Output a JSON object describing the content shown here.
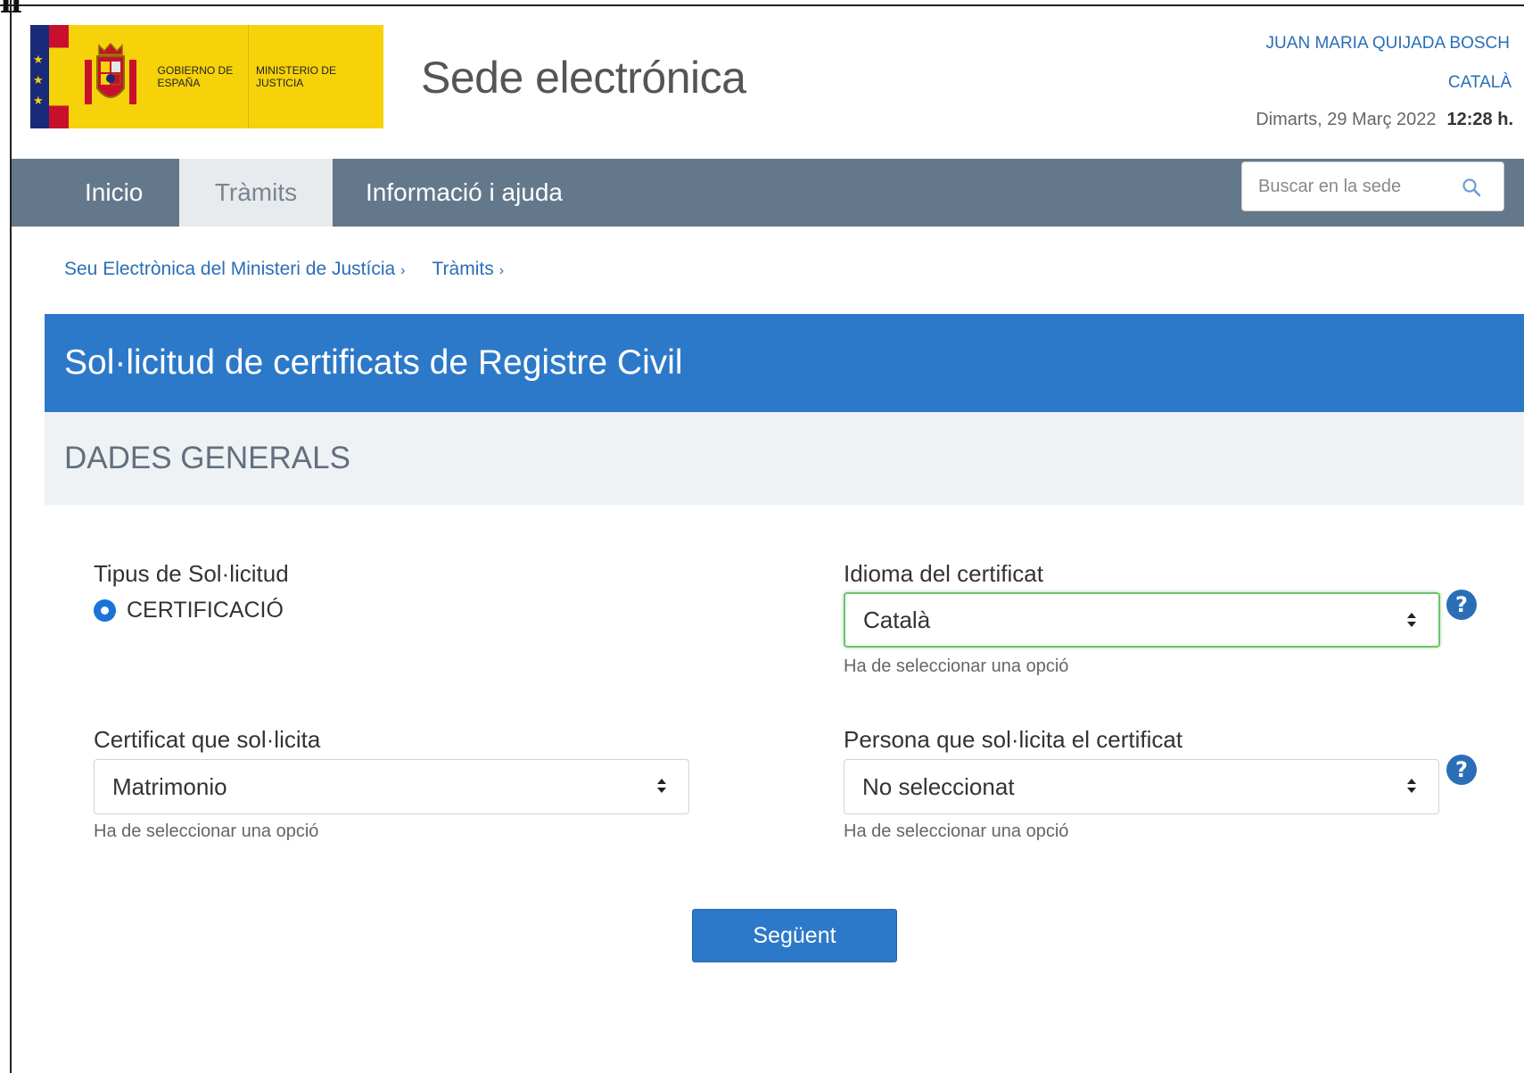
{
  "header": {
    "logo_gov": "GOBIERNO DE ESPAÑA",
    "logo_ministry": "MINISTERIO DE JUSTICIA",
    "site_title": "Sede electrónica",
    "user_name": "JUAN MARIA QUIJADA BOSCH",
    "language_link": "CATALÀ",
    "date": "Dimarts, 29 Març 2022",
    "time": "12:28 h."
  },
  "nav": {
    "items": [
      {
        "label": "Inicio",
        "active": false
      },
      {
        "label": "Tràmits",
        "active": true
      },
      {
        "label": "Informació i ajuda",
        "active": false
      }
    ],
    "search_placeholder": "Buscar en la sede"
  },
  "breadcrumb": [
    {
      "label": "Seu Electrònica del Ministeri de Justícia",
      "sep": "›"
    },
    {
      "label": "Tràmits",
      "sep": "›"
    }
  ],
  "page": {
    "title": "Sol·licitud de certificats de Registre Civil",
    "section": "DADES GENERALS"
  },
  "form": {
    "request_type": {
      "label": "Tipus de Sol·licitud",
      "option": "CERTIFICACIÓ",
      "selected": true
    },
    "language": {
      "label": "Idioma del certificat",
      "value": "Català",
      "hint": "Ha de seleccionar una opció"
    },
    "certificate": {
      "label": "Certificat que sol·licita",
      "value": "Matrimonio",
      "hint": "Ha de seleccionar una opció"
    },
    "requester": {
      "label": "Persona que sol·licita el certificat",
      "value": "No seleccionat",
      "hint": "Ha de seleccionar una opció"
    },
    "help_glyph": "?",
    "next_label": "Següent"
  },
  "colors": {
    "nav_bg": "#63788b",
    "banner_bg": "#2d79c9",
    "link": "#2a6eb8",
    "focus_border": "#6cc46c",
    "logo_yellow": "#f5d20a"
  },
  "icons": [
    "search-icon",
    "help-icon",
    "select-caret-icon",
    "spain-crest-icon"
  ]
}
